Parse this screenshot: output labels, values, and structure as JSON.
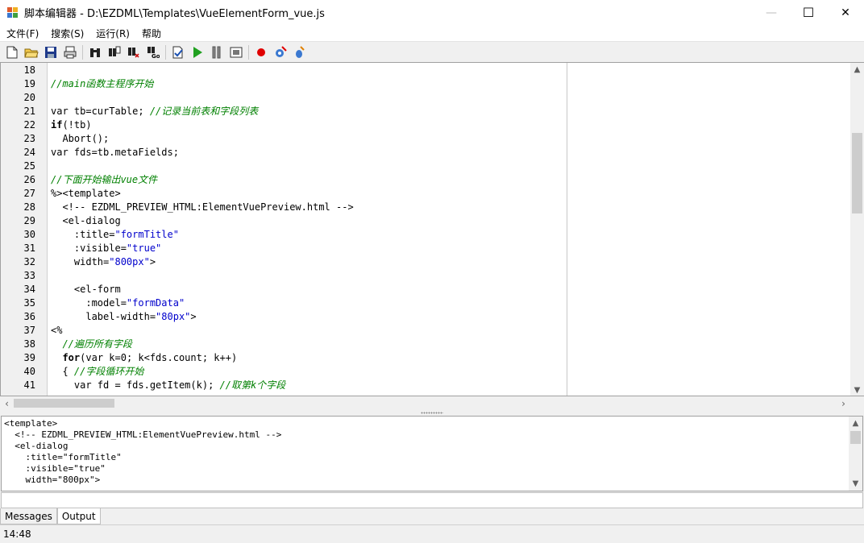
{
  "window": {
    "title": "脚本编辑器 - D:\\EZDML\\Templates\\VueElementForm_vue.js",
    "minimize_glyph": "—",
    "maximize_glyph": "☐",
    "close_glyph": "✕"
  },
  "menu": [
    "文件(F)",
    "搜索(S)",
    "运行(R)",
    "帮助"
  ],
  "toolbar": {
    "icons": [
      "new-file-icon",
      "open-folder-icon",
      "save-icon",
      "print-preview-icon",
      "find-binoculars-icon",
      "find-next-icon",
      "replace-icon",
      "goto-line-icon",
      "check-syntax-icon",
      "run-icon",
      "pause-icon",
      "step-icon",
      "breakpoint-icon",
      "toggle-breakpoint-icon",
      "debug-icon"
    ]
  },
  "editor": {
    "lines": [
      {
        "num": "18",
        "parts": [
          {
            "t": "",
            "c": ""
          }
        ]
      },
      {
        "num": "19",
        "parts": [
          {
            "t": "//main函数主程序开始",
            "c": "c"
          }
        ]
      },
      {
        "num": "20",
        "parts": [
          {
            "t": "",
            "c": ""
          }
        ]
      },
      {
        "num": "21",
        "parts": [
          {
            "t": "var tb=curTable; ",
            "c": ""
          },
          {
            "t": "//记录当前表和字段列表",
            "c": "c"
          }
        ]
      },
      {
        "num": "22",
        "parts": [
          {
            "t": "if",
            "c": "k"
          },
          {
            "t": "(!tb)",
            "c": ""
          }
        ]
      },
      {
        "num": "23",
        "parts": [
          {
            "t": "  Abort();",
            "c": ""
          }
        ]
      },
      {
        "num": "24",
        "parts": [
          {
            "t": "var fds=tb.metaFields;",
            "c": ""
          }
        ]
      },
      {
        "num": "25",
        "parts": [
          {
            "t": "",
            "c": ""
          }
        ]
      },
      {
        "num": "26",
        "parts": [
          {
            "t": "//下面开始输出vue文件",
            "c": "c"
          }
        ]
      },
      {
        "num": "27",
        "parts": [
          {
            "t": "%><template>",
            "c": ""
          }
        ]
      },
      {
        "num": "28",
        "parts": [
          {
            "t": "  <!-- EZDML_PREVIEW_HTML:ElementVuePreview.html -->",
            "c": ""
          }
        ]
      },
      {
        "num": "29",
        "parts": [
          {
            "t": "  <el-dialog",
            "c": ""
          }
        ]
      },
      {
        "num": "30",
        "parts": [
          {
            "t": "    :title=",
            "c": ""
          },
          {
            "t": "\"formTitle\"",
            "c": "s"
          }
        ]
      },
      {
        "num": "31",
        "parts": [
          {
            "t": "    :visible=",
            "c": ""
          },
          {
            "t": "\"true\"",
            "c": "s"
          }
        ]
      },
      {
        "num": "32",
        "parts": [
          {
            "t": "    width=",
            "c": ""
          },
          {
            "t": "\"800px\"",
            "c": "s"
          },
          {
            "t": ">",
            "c": ""
          }
        ]
      },
      {
        "num": "33",
        "parts": [
          {
            "t": "",
            "c": ""
          }
        ]
      },
      {
        "num": "34",
        "parts": [
          {
            "t": "    <el-form",
            "c": ""
          }
        ]
      },
      {
        "num": "35",
        "parts": [
          {
            "t": "      :model=",
            "c": ""
          },
          {
            "t": "\"formData\"",
            "c": "s"
          }
        ]
      },
      {
        "num": "36",
        "parts": [
          {
            "t": "      label-width=",
            "c": ""
          },
          {
            "t": "\"80px\"",
            "c": "s"
          },
          {
            "t": ">",
            "c": ""
          }
        ]
      },
      {
        "num": "37",
        "parts": [
          {
            "t": "<%",
            "c": ""
          }
        ]
      },
      {
        "num": "38",
        "parts": [
          {
            "t": "  //遍历所有字段",
            "c": "c"
          }
        ]
      },
      {
        "num": "39",
        "parts": [
          {
            "t": "  ",
            "c": ""
          },
          {
            "t": "for",
            "c": "k"
          },
          {
            "t": "(var k=0; k<fds.count; k++)",
            "c": ""
          }
        ]
      },
      {
        "num": "40",
        "parts": [
          {
            "t": "  { ",
            "c": ""
          },
          {
            "t": "//字段循环开始",
            "c": "c"
          }
        ]
      },
      {
        "num": "41",
        "parts": [
          {
            "t": "    var fd = fds.getItem(k); ",
            "c": ""
          },
          {
            "t": "//取第k个字段",
            "c": "c"
          }
        ]
      }
    ]
  },
  "output_lines": [
    "<template>",
    "  <!-- EZDML_PREVIEW_HTML:ElementVuePreview.html -->",
    "  <el-dialog",
    "    :title=\"formTitle\"",
    "    :visible=\"true\"",
    "    width=\"800px\">"
  ],
  "tabs": [
    {
      "label": "Messages",
      "active": false
    },
    {
      "label": "Output",
      "active": true
    }
  ],
  "status": {
    "time": "14:48"
  },
  "colors": {
    "comment": "#008000",
    "string": "#0000cc",
    "breakpoint": "#e00000",
    "run": "#20a020"
  }
}
